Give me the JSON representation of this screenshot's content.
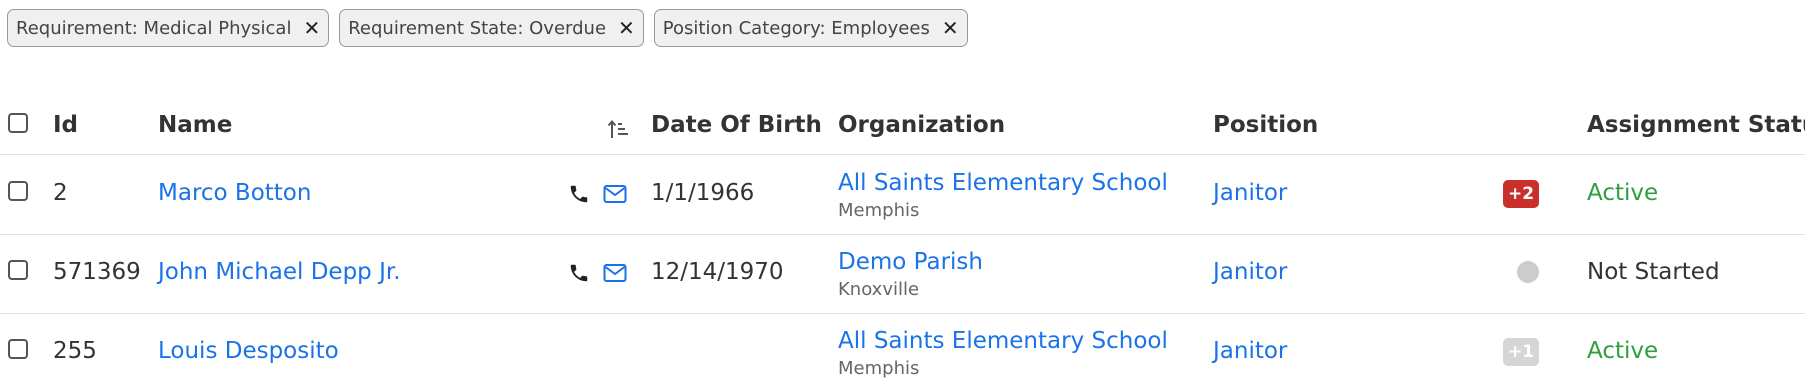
{
  "filters": [
    {
      "label": "Requirement: Medical Physical"
    },
    {
      "label": "Requirement State: Overdue"
    },
    {
      "label": "Position Category: Employees"
    }
  ],
  "remove_glyph": "✕",
  "columns": {
    "id": "Id",
    "name": "Name",
    "dob": "Date Of Birth",
    "organization": "Organization",
    "position": "Position",
    "status": "Assignment Status"
  },
  "rows": [
    {
      "id": "2",
      "name": "Marco Botton",
      "has_contact": true,
      "dob": "1/1/1966",
      "org": "All Saints Elementary School",
      "city": "Memphis",
      "position": "Janitor",
      "indicator": {
        "type": "badge",
        "text": "+2",
        "color": "#c9302c"
      },
      "status": "Active",
      "status_color": "#2e9e3e"
    },
    {
      "id": "571369",
      "name": "John Michael Depp Jr.",
      "has_contact": true,
      "dob": "12/14/1970",
      "org": "Demo Parish",
      "city": "Knoxville",
      "position": "Janitor",
      "indicator": {
        "type": "dot",
        "text": "",
        "color": "#cccccc"
      },
      "status": "Not Started",
      "status_color": "#333333"
    },
    {
      "id": "255",
      "name": "Louis Desposito",
      "has_contact": false,
      "dob": "",
      "org": "All Saints Elementary School",
      "city": "Memphis",
      "position": "Janitor",
      "indicator": {
        "type": "badge",
        "text": "+1",
        "color": "#d6d6d6"
      },
      "status": "Active",
      "status_color": "#2e9e3e"
    }
  ],
  "icons": {
    "remove": "close-icon",
    "sort": "sort-ascending-icon",
    "phone": "phone-icon",
    "email": "envelope-icon"
  },
  "colors": {
    "link": "#1a73e8",
    "active": "#2e9e3e",
    "badge_red": "#c9302c"
  }
}
